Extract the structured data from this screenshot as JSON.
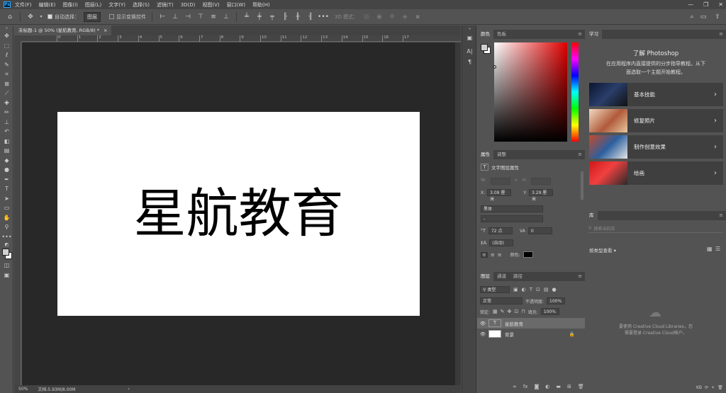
{
  "app": {
    "logo": "Ps"
  },
  "menubar": {
    "items": [
      "文件(F)",
      "编辑(E)",
      "图像(I)",
      "图层(L)",
      "文字(Y)",
      "选择(S)",
      "滤镜(T)",
      "3D(D)",
      "视图(V)",
      "窗口(W)",
      "帮助(H)"
    ],
    "window_controls": [
      "—",
      "❐",
      "✕"
    ]
  },
  "options": {
    "auto_select_label": "自动选择：",
    "auto_select_value": "图层",
    "show_transform_label": "显示变换控件",
    "mode_label": "3D 模式："
  },
  "document": {
    "tab_title": "未标题-1 @ 50% (星航教育, RGB/8) *",
    "close": "×",
    "canvas_text": "星航教育",
    "zoom": "50%",
    "doc_size": "文档:5.93M/8.00M",
    "ruler_h_labels": [
      "0",
      "1",
      "2",
      "3",
      "4",
      "5",
      "6",
      "7",
      "8",
      "9",
      "10",
      "11",
      "12",
      "13",
      "14",
      "15",
      "16",
      "17"
    ]
  },
  "color_panel": {
    "tabs": [
      "颜色",
      "色板"
    ],
    "fg": "#d0d0d0",
    "bg": "#ffffff"
  },
  "properties_panel": {
    "tabs": [
      "属性",
      "调整"
    ],
    "header": "文字图层属性",
    "w_label": "W:",
    "h_label": "H:",
    "x_label": "X:",
    "x_value": "3.09 厘米",
    "y_label": "Y:",
    "y_value": "3.29 厘米",
    "font_family": "黑体",
    "font_style": "-",
    "font_size": "72 点",
    "tracking": "0",
    "leading": "(自动)",
    "color_label": "颜色:"
  },
  "layers_panel": {
    "tabs": [
      "图层",
      "通道",
      "路径"
    ],
    "filter_label": "类型",
    "blend_mode": "正常",
    "opacity_label": "不透明度:",
    "opacity_value": "100%",
    "lock_label": "锁定:",
    "fill_label": "填充:",
    "fill_value": "100%",
    "layers": [
      {
        "name": "星航教育",
        "type": "text",
        "thumb": "T"
      },
      {
        "name": "背景",
        "type": "background",
        "thumb": ""
      }
    ]
  },
  "learn_panel": {
    "tab": "学习",
    "title": "了解 Photoshop",
    "subtitle_line1": "在应用程序内直接提供的分步指导教程。从下",
    "subtitle_line2": "面选取一个主题开始教程。",
    "cards": [
      {
        "label": "基本技能",
        "chevron": "›"
      },
      {
        "label": "修复照片",
        "chevron": "›"
      },
      {
        "label": "制作创意效果",
        "chevron": "›"
      },
      {
        "label": "绘画",
        "chevron": "›"
      }
    ]
  },
  "libraries_panel": {
    "tab": "库",
    "search_placeholder": "搜索当前库",
    "view_by": "按类型查看",
    "info_line1": "要使用 Creative Cloud Libraries，您",
    "info_line2": "需要登录 Creative Cloud帐户。",
    "kb": "KB"
  }
}
